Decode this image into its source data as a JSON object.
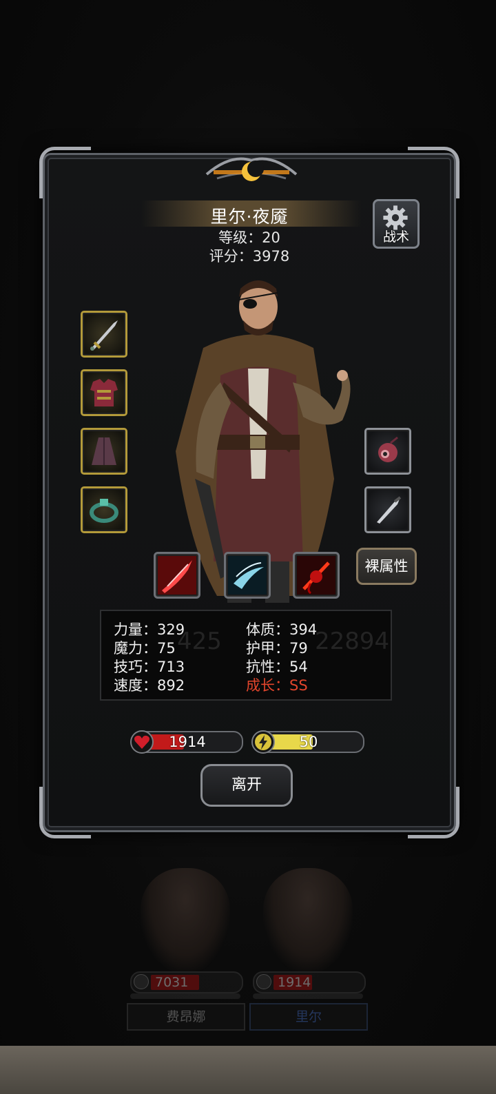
{
  "hero": {
    "name": "里尔·夜魇",
    "level_text": "等级：20",
    "score_text": "评分：3978"
  },
  "buttons": {
    "tactics": "战术",
    "bare_attributes": "裸属性",
    "leave": "离开"
  },
  "equipment": {
    "left": [
      {
        "icon": "sword-icon"
      },
      {
        "icon": "chest-armor-icon"
      },
      {
        "icon": "cloak-icon"
      },
      {
        "icon": "ring-icon"
      }
    ],
    "right": [
      {
        "icon": "eye-trinket-icon"
      },
      {
        "icon": "dagger-icon"
      }
    ]
  },
  "skills": [
    {
      "icon": "red-slash-skill-icon"
    },
    {
      "icon": "blue-slash-skill-icon"
    },
    {
      "icon": "blood-strike-skill-icon"
    }
  ],
  "stats": {
    "strength": "力量：329",
    "magic": "魔力：75",
    "skill": "技巧：713",
    "speed": "速度：892",
    "constitution": "体质：394",
    "armor": "护甲：79",
    "resistance": "抗性：54",
    "growth": "成长：SS",
    "ghost_left": "425",
    "ghost_right": "22894"
  },
  "bars": {
    "hp": {
      "value": "1914",
      "fill_fraction": 0.42,
      "color": "#c21a1a"
    },
    "energy": {
      "value": "50",
      "fill_fraction": 0.5,
      "color": "#e8d84a"
    }
  },
  "team": [
    {
      "name": "费昂娜",
      "hp": "7031",
      "hp_fraction": 0.62
    },
    {
      "name": "里尔",
      "hp": "1914",
      "hp_fraction": 0.45
    }
  ],
  "colors": {
    "growth": "#e2452c",
    "gold_border": "#b39a3a"
  }
}
